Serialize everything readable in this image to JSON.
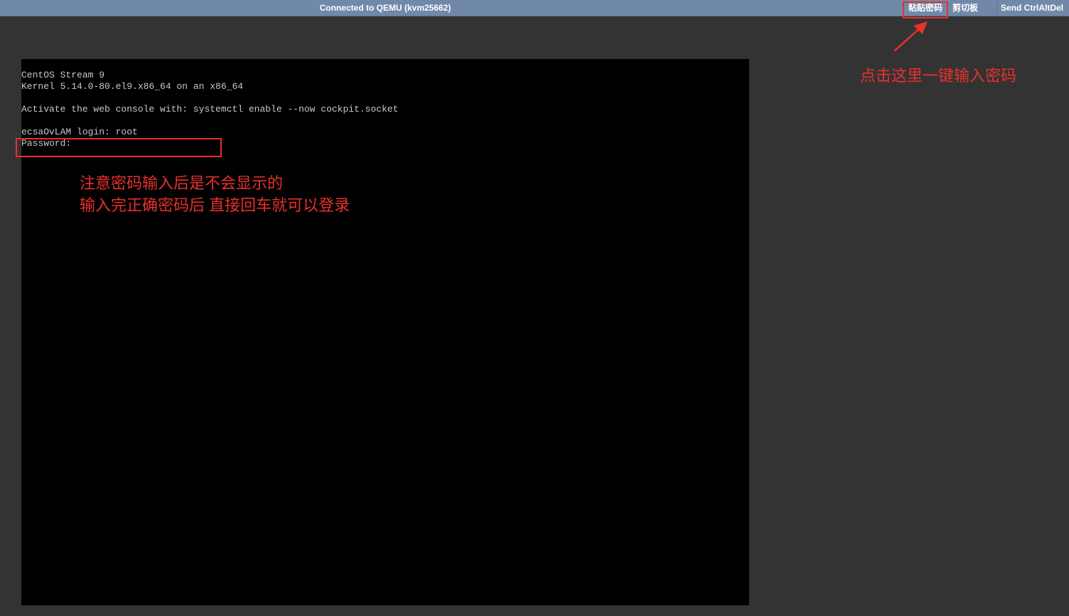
{
  "topbar": {
    "status": "Connected to QEMU (kvm25662)",
    "paste_password_label": "粘贴密码",
    "clipboard_label": "剪切板",
    "send_cad_label": "Send CtrlAltDel"
  },
  "console": {
    "lines": [
      "CentOS Stream 9",
      "Kernel 5.14.0-80.el9.x86_64 on an x86_64",
      "",
      "Activate the web console with: systemctl enable --now cockpit.socket",
      "",
      "ecsaOvLAM login: root",
      "Password:"
    ]
  },
  "annotations": {
    "screen_note_line1": "注意密码输入后是不会显示的",
    "screen_note_line2": "输入完正确密码后 直接回车就可以登录",
    "paste_note": "点击这里一键输入密码",
    "color": "#e8302c"
  },
  "colors": {
    "topbar_bg": "#7189a9",
    "page_bg": "#333333",
    "screen_bg": "#000000",
    "terminal_text": "#c8c8c8"
  }
}
